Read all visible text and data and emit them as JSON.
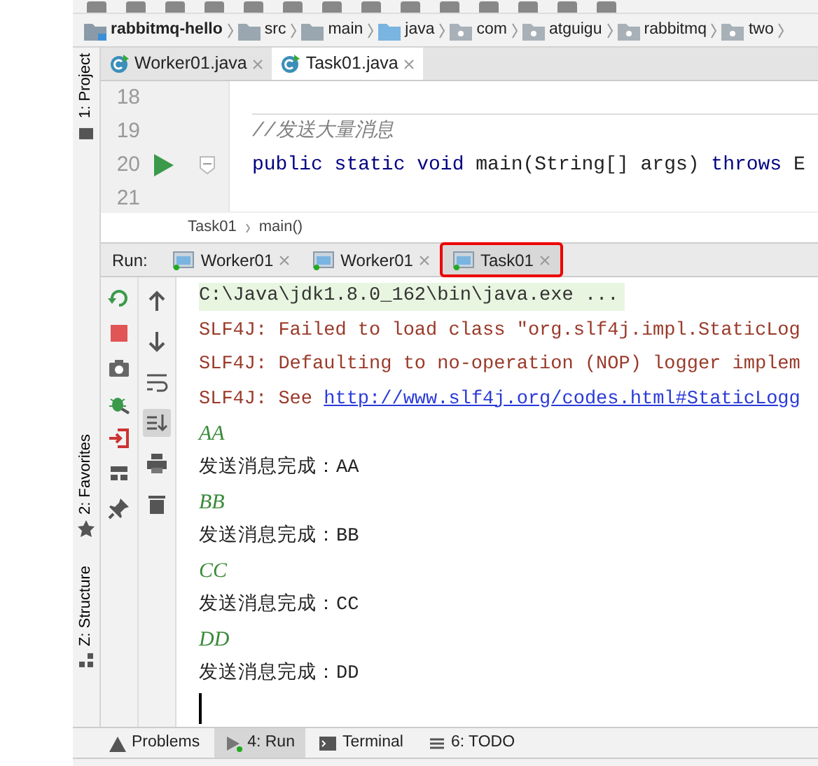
{
  "breadcrumb": [
    {
      "label": "rabbitmq-hello",
      "kind": "module"
    },
    {
      "label": "src",
      "kind": "folder"
    },
    {
      "label": "main",
      "kind": "folder"
    },
    {
      "label": "java",
      "kind": "source"
    },
    {
      "label": "com",
      "kind": "package"
    },
    {
      "label": "atguigu",
      "kind": "package"
    },
    {
      "label": "rabbitmq",
      "kind": "package"
    },
    {
      "label": "two",
      "kind": "package"
    }
  ],
  "side_strip": [
    {
      "label": "1: Project",
      "kind": "project"
    },
    {
      "label": "2: Favorites",
      "kind": "favorites"
    },
    {
      "label": "Z: Structure",
      "kind": "structure"
    }
  ],
  "editor_tabs": [
    {
      "label": "Worker01.java",
      "selected": false
    },
    {
      "label": "Task01.java",
      "selected": true
    }
  ],
  "editor": {
    "lines": [
      {
        "number": "18",
        "run": false
      },
      {
        "number": "19",
        "run": false,
        "tokens": [
          {
            "kind": "comment",
            "text": "//发送大量消息"
          }
        ]
      },
      {
        "number": "20",
        "run": true,
        "tokens": [
          {
            "kind": "keyword",
            "text": "public static void "
          },
          {
            "kind": "plain",
            "text": "main(String[] args) "
          },
          {
            "kind": "keyword",
            "text": "throws "
          },
          {
            "kind": "plain",
            "text": "E"
          }
        ]
      },
      {
        "number": "21",
        "run": false
      }
    ]
  },
  "editor_breadcrumb": [
    "Task01",
    "main()"
  ],
  "run_panel": {
    "label": "Run:",
    "tabs": [
      {
        "label": "Worker01",
        "selected": false,
        "highlighted": false
      },
      {
        "label": "Worker01",
        "selected": false,
        "highlighted": false
      },
      {
        "label": "Task01",
        "selected": true,
        "highlighted": true
      }
    ]
  },
  "console": [
    {
      "kind": "command",
      "text": "C:\\Java\\jdk1.8.0_162\\bin\\java.exe ..."
    },
    {
      "kind": "error",
      "text": "SLF4J: Failed to load class \"org.slf4j.impl.StaticLog"
    },
    {
      "kind": "error",
      "text": "SLF4J: Defaulting to no-operation (NOP) logger implem"
    },
    {
      "kind": "link",
      "text": "SLF4J: See ",
      "link": "http://www.slf4j.org/codes.html#StaticLogg"
    },
    {
      "kind": "input",
      "text": "AA"
    },
    {
      "kind": "output",
      "text": "发送消息完成：AA"
    },
    {
      "kind": "input",
      "text": "BB"
    },
    {
      "kind": "output",
      "text": "发送消息完成：BB"
    },
    {
      "kind": "input",
      "text": "CC"
    },
    {
      "kind": "output",
      "text": "发送消息完成：CC"
    },
    {
      "kind": "input",
      "text": "DD"
    },
    {
      "kind": "output",
      "text": "发送消息完成：DD"
    }
  ],
  "bottom_tabs": [
    {
      "label": "Problems",
      "kind": "problems",
      "selected": false
    },
    {
      "label": "4: Run",
      "kind": "run",
      "selected": true
    },
    {
      "label": "Terminal",
      "kind": "terminal",
      "selected": false
    },
    {
      "label": "6: TODO",
      "kind": "todo",
      "selected": false
    }
  ]
}
